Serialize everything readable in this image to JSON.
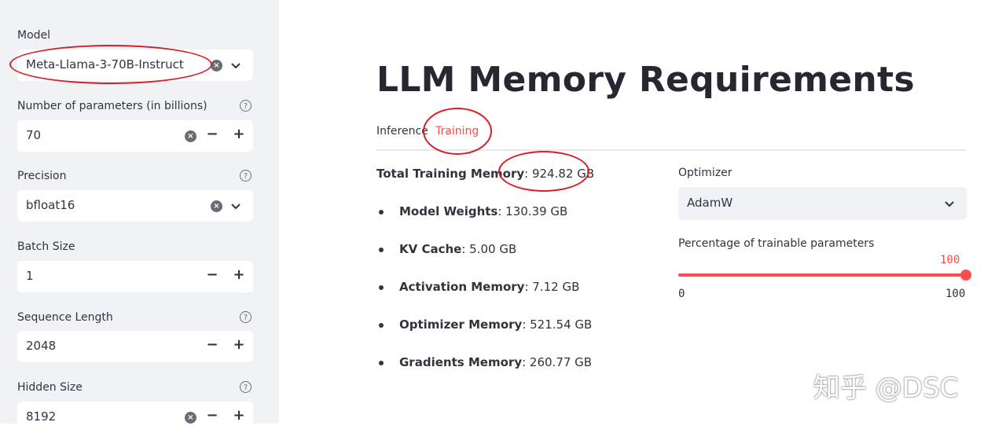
{
  "sidebar": {
    "model": {
      "label": "Model",
      "value": "Meta-Llama-3-70B-Instruct"
    },
    "params": {
      "label": "Number of parameters (in billions)",
      "value": "70"
    },
    "precision": {
      "label": "Precision",
      "value": "bfloat16"
    },
    "batch": {
      "label": "Batch Size",
      "value": "1"
    },
    "seq": {
      "label": "Sequence Length",
      "value": "2048"
    },
    "hidden": {
      "label": "Hidden Size",
      "value": "8192"
    },
    "help_glyph": "?",
    "minus": "−",
    "plus": "+",
    "clear": "×"
  },
  "main": {
    "title": "LLM Memory Requirements",
    "tabs": [
      {
        "label": "Inference"
      },
      {
        "label": "Training",
        "active": true
      }
    ],
    "total": {
      "label": "Total Training Memory",
      "value": ": 924.82 GB"
    },
    "items": [
      {
        "label": "Model Weights",
        "value": ": 130.39 GB"
      },
      {
        "label": "KV Cache",
        "value": ": 5.00 GB"
      },
      {
        "label": "Activation Memory",
        "value": ": 7.12 GB"
      },
      {
        "label": "Optimizer Memory",
        "value": ": 521.54 GB"
      },
      {
        "label": "Gradients Memory",
        "value": ": 260.77 GB"
      }
    ],
    "optimizer": {
      "label": "Optimizer",
      "value": "AdamW"
    },
    "slider": {
      "label": "Percentage of trainable parameters",
      "value": "100",
      "min": "0",
      "max": "100",
      "fraction": 1.0
    }
  },
  "watermark": "知乎 @DSC",
  "colors": {
    "accent": "#ff4b4b",
    "sidebar_bg": "#f0f2f6",
    "annotation": "#d91f26"
  }
}
